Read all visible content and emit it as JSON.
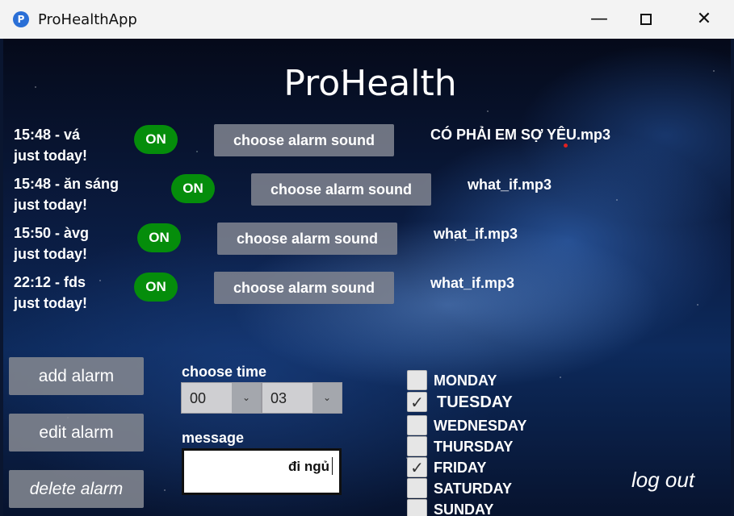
{
  "window": {
    "title": "ProHealthApp",
    "icon_letter": "P",
    "minimize_glyph": "—",
    "close_glyph": "✕"
  },
  "app": {
    "title": "ProHealth"
  },
  "alarms": [
    {
      "line1": "15:48 - vá",
      "line2": "just today!",
      "status": "ON",
      "sound_button": "choose alarm sound",
      "sound_file": "CÓ PHẢI EM SỢ YÊU.mp3"
    },
    {
      "line1": "15:48 - ăn sáng",
      "line2": "just today!",
      "status": "ON",
      "sound_button": "choose alarm sound",
      "sound_file": "what_if.mp3"
    },
    {
      "line1": "15:50 - àvg",
      "line2": "just today!",
      "status": "ON",
      "sound_button": "choose alarm sound",
      "sound_file": "what_if.mp3"
    },
    {
      "line1": "22:12 - fds",
      "line2": "just today!",
      "status": "ON",
      "sound_button": "choose alarm sound",
      "sound_file": "what_if.mp3"
    }
  ],
  "actions": {
    "add": "add alarm",
    "edit": "edit alarm",
    "delete": "delete alarm"
  },
  "time_picker": {
    "label": "choose time",
    "hour": "00",
    "minute": "03",
    "arrow_glyph": "⌄"
  },
  "message": {
    "label": "message",
    "value": "đi ngủ"
  },
  "days": [
    {
      "label": "MONDAY",
      "checked": false
    },
    {
      "label": "TUESDAY",
      "checked": true
    },
    {
      "label": "WEDNESDAY",
      "checked": false
    },
    {
      "label": "THURSDAY",
      "checked": false
    },
    {
      "label": "FRIDAY",
      "checked": true
    },
    {
      "label": "SATURDAY",
      "checked": false
    },
    {
      "label": "SUNDAY",
      "checked": false
    }
  ],
  "check_glyph": "✓",
  "logout": "log out",
  "colors": {
    "on_badge": "#058d0b",
    "button_gray": "#80848e",
    "text": "#ffffff"
  }
}
